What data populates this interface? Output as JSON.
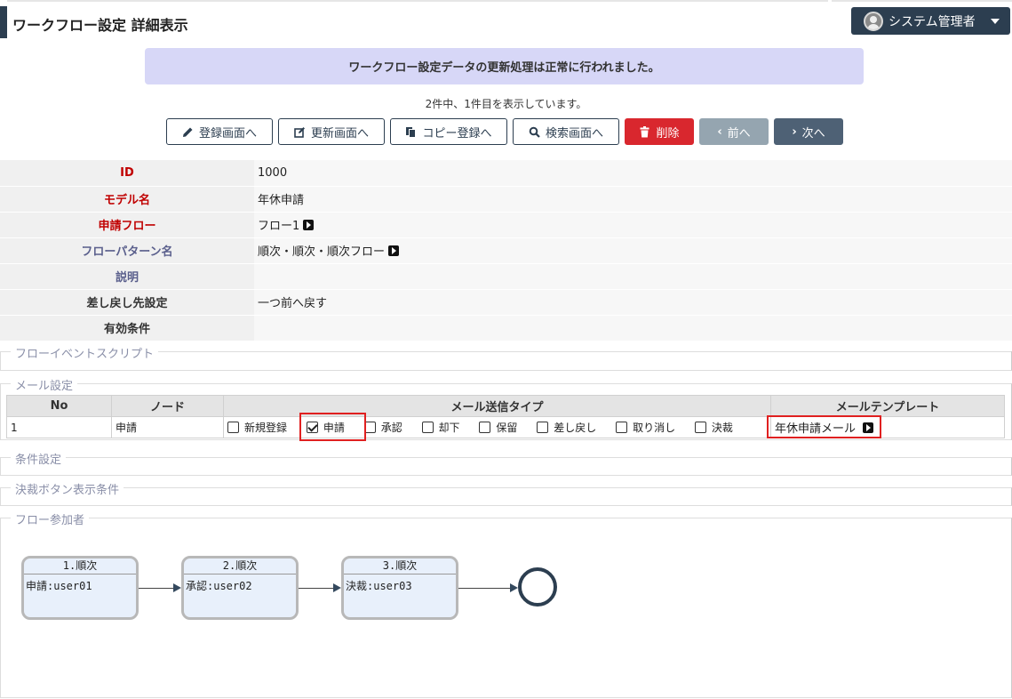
{
  "header": {
    "title": "ワークフロー設定 詳細表示",
    "user": "システム管理者"
  },
  "message": "ワークフロー設定データの更新処理は正常に行われました。",
  "record_count": "2件中、1件目を表示しています。",
  "buttons": {
    "register": "登録画面へ",
    "update": "更新画面へ",
    "copy": "コピー登録へ",
    "search": "検索画面へ",
    "delete": "削除",
    "prev": "前へ",
    "next": "次へ"
  },
  "detail": [
    {
      "label": "ID",
      "value": "1000"
    },
    {
      "label": "モデル名",
      "value": "年休申請"
    },
    {
      "label": "申請フロー",
      "value": "フロー1"
    },
    {
      "label": "フローパターン名",
      "value": "順次・順次・順次フロー"
    },
    {
      "label": "説明",
      "value": ""
    },
    {
      "label": "差し戻し先設定",
      "value": "一つ前へ戻す"
    },
    {
      "label": "有効条件",
      "value": ""
    }
  ],
  "sections": {
    "script": "フローイベントスクリプト",
    "mail": "メール設定",
    "condition": "条件設定",
    "decision": "決裁ボタン表示条件",
    "participants": "フロー参加者"
  },
  "mail_table": {
    "headers": [
      "No",
      "ノード",
      "メール送信タイプ",
      "メールテンプレート"
    ],
    "row": {
      "no": "1",
      "node": "申請",
      "types": [
        {
          "label": "新規登録",
          "checked": false
        },
        {
          "label": "申請",
          "checked": true
        },
        {
          "label": "承認",
          "checked": false
        },
        {
          "label": "却下",
          "checked": false
        },
        {
          "label": "保留",
          "checked": false
        },
        {
          "label": "差し戻し",
          "checked": false
        },
        {
          "label": "取り消し",
          "checked": false
        },
        {
          "label": "決裁",
          "checked": false
        }
      ],
      "template": "年休申請メール"
    }
  },
  "flow": [
    {
      "title": "1.順次",
      "body": "申請:user01"
    },
    {
      "title": "2.順次",
      "body": "承認:user02"
    },
    {
      "title": "3.順次",
      "body": "決裁:user03"
    }
  ],
  "colors": {
    "primary": "#2c3e50",
    "danger": "#d9272e",
    "message_bg": "#d7d7f7",
    "required_label": "#c00000"
  }
}
